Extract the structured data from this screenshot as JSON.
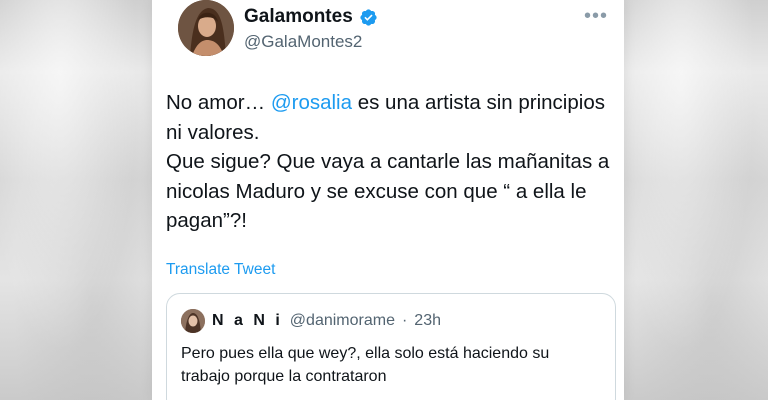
{
  "tweet": {
    "author": {
      "display_name": "Galamontes",
      "handle": "@GalaMontes2",
      "verified_icon": "verified-badge-icon"
    },
    "more_icon": "more-options-icon",
    "more_label": "•••",
    "text_part1": "No amor… ",
    "mention": "@rosalia",
    "text_part2": " es una artista sin principios ni valores.\nQue sigue? Que vaya a cantarle las mañanitas a nicolas Maduro y se excuse con que “ a ella le pagan”?!",
    "translate_label": "Translate Tweet"
  },
  "quote": {
    "display_name": "N a N i",
    "handle": "@danimorame",
    "separator": "·",
    "time": "23h",
    "text": "Pero pues ella que wey?, ella solo está haciendo su trabajo porque la contrataron"
  },
  "colors": {
    "accent": "#1d9bf0",
    "text_primary": "#0f1419",
    "text_secondary": "#536471",
    "border": "#cfd9de"
  }
}
